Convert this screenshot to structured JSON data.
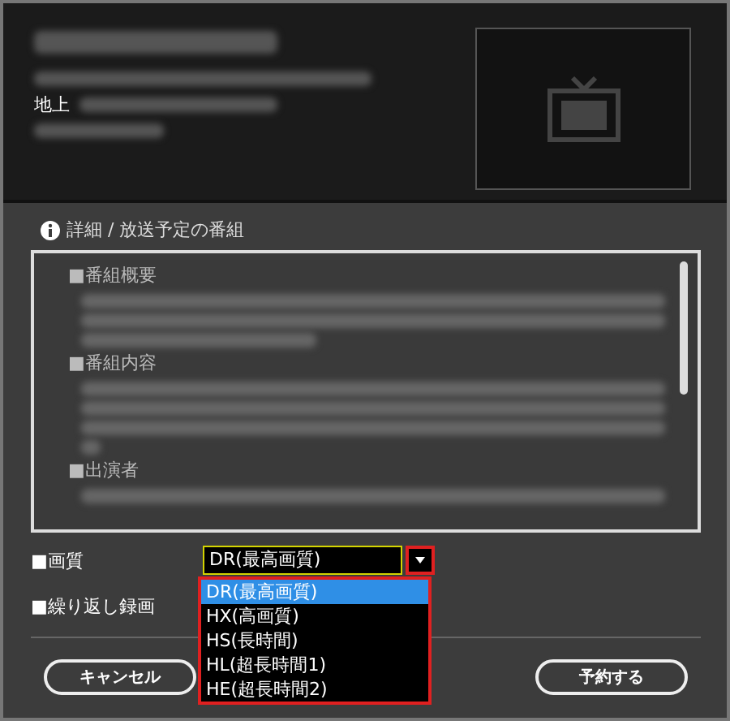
{
  "header": {
    "broadcast_type": "地上"
  },
  "details": {
    "title": "詳細 / 放送予定の番組",
    "sections": [
      {
        "heading": "■番組概要"
      },
      {
        "heading": "■番組内容"
      },
      {
        "heading": "■出演者"
      }
    ]
  },
  "settings": [
    {
      "kind": "select",
      "label": "■画質",
      "value": "DR(最高画質)",
      "expanded": true,
      "options": [
        {
          "label": "DR(最高画質)",
          "selected": true
        },
        {
          "label": "HX(高画質)",
          "selected": false
        },
        {
          "label": "HS(長時間)",
          "selected": false
        },
        {
          "label": "HL(超長時間1)",
          "selected": false
        },
        {
          "label": "HE(超長時間2)",
          "selected": false
        }
      ]
    },
    {
      "kind": "label",
      "label": "■繰り返し録画"
    }
  ],
  "buttons": [
    {
      "label": "キャンセル"
    },
    {
      "label": "予約する"
    }
  ]
}
